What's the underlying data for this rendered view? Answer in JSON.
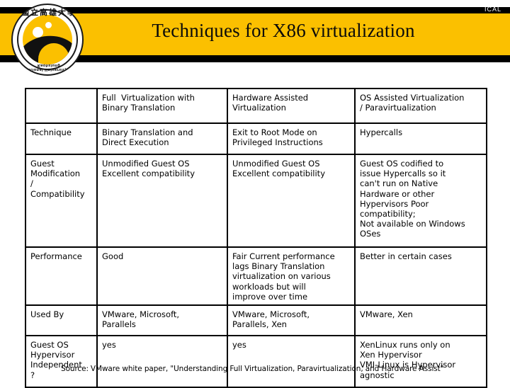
{
  "header": {
    "title": "Techniques for X86 virtualization",
    "corner_tag": "ICAL",
    "bar_color": "#fbc000",
    "bar_accent_color": "#000000",
    "title_color": "#0a0a0a"
  },
  "logo": {
    "name": "national-university-of-kaohsiung-logo",
    "chinese_text": "國立高雄大學",
    "english_text": "National University of Kaohsiung",
    "disc_color": "#fbc000"
  },
  "table": {
    "columns": [
      "",
      "Full  Virtualization with Binary Translation",
      "Hardware Assisted Virtualization",
      "OS Assisted Virtualization / Paravirtualization"
    ],
    "header": {
      "label": "",
      "full_virtualization": [
        "Full  Virtualization with",
        "Binary Translation"
      ],
      "hardware_assisted": [
        "Hardware Assisted",
        "Virtualization"
      ],
      "os_assisted": [
        "OS Assisted Virtualization",
        "/ Paravirtualization"
      ]
    },
    "rows": [
      {
        "label": [
          "Technique"
        ],
        "full_virtualization": [
          "Binary Translation and",
          "Direct Execution"
        ],
        "hardware_assisted": [
          "Exit to Root Mode on",
          "Privileged Instructions"
        ],
        "os_assisted": [
          "Hypercalls"
        ]
      },
      {
        "label": [
          "Guest",
          "Modification",
          "/",
          "Compatibility"
        ],
        "full_virtualization": [
          "Unmodified Guest OS",
          "Excellent compatibility"
        ],
        "hardware_assisted": [
          "Unmodified Guest OS",
          "Excellent compatibility"
        ],
        "os_assisted": [
          "Guest OS codified to",
          "issue Hypercalls so it",
          "can't run on Native",
          "Hardware or other",
          "Hypervisors Poor",
          "compatibility;",
          "Not available on Windows",
          "OSes"
        ]
      },
      {
        "label": [
          "Performance"
        ],
        "full_virtualization": [
          "Good"
        ],
        "hardware_assisted": [
          "Fair Current performance",
          "lags Binary Translation",
          "virtualization on various",
          "workloads but will",
          "improve over time"
        ],
        "os_assisted": [
          "Better in certain cases"
        ]
      },
      {
        "label": [
          "Used By"
        ],
        "full_virtualization": [
          "VMware, Microsoft,",
          "Parallels"
        ],
        "hardware_assisted": [
          "VMware, Microsoft,",
          "Parallels, Xen"
        ],
        "os_assisted": [
          "VMware, Xen"
        ]
      },
      {
        "label": [
          "Guest OS",
          "Hypervisor",
          "Independent",
          "?"
        ],
        "full_virtualization": [
          "yes"
        ],
        "hardware_assisted": [
          "yes"
        ],
        "os_assisted": [
          "XenLinux runs only on",
          "Xen Hypervisor",
          "VMI-Linux is Hypervisor",
          "agnostic"
        ]
      }
    ]
  },
  "footnote": {
    "source_label": "Source:",
    "source_text": "VMware white paper, \"Understanding Full Virtualization, Paravirtualization, and Hardware Assist\""
  }
}
